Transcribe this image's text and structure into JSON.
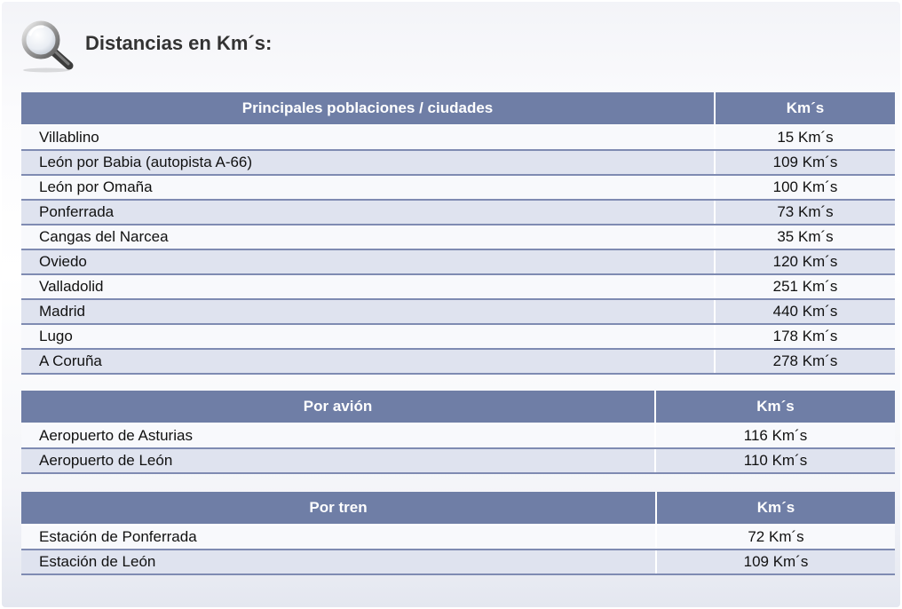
{
  "header": {
    "title": "Distancias en Km´s:",
    "icon": "magnifier-icon"
  },
  "colors": {
    "header_bg": "#6f7ea6",
    "row_even_bg": "#dfe3ef",
    "row_odd_bg": "#f8f9fc",
    "row_divider": "#7f8bb2"
  },
  "cities_table": {
    "col_place": "Principales poblaciones / ciudades",
    "col_km": "Km´s",
    "rows": [
      {
        "place": "Villablino",
        "km": "15 Km´s"
      },
      {
        "place": "León por Babia (autopista A-66)",
        "km": "109 Km´s"
      },
      {
        "place": "León por Omaña",
        "km": "100 Km´s"
      },
      {
        "place": "Ponferrada",
        "km": "73 Km´s"
      },
      {
        "place": "Cangas del Narcea",
        "km": "35 Km´s"
      },
      {
        "place": "Oviedo",
        "km": "120 Km´s"
      },
      {
        "place": "Valladolid",
        "km": "251 Km´s"
      },
      {
        "place": "Madrid",
        "km": "440 Km´s"
      },
      {
        "place": "Lugo",
        "km": "178 Km´s"
      },
      {
        "place": "A Coruña",
        "km": "278 Km´s"
      }
    ]
  },
  "plane_table": {
    "col_place": "Por avión",
    "col_km": "Km´s",
    "rows": [
      {
        "place": "Aeropuerto de Asturias",
        "km": "116 Km´s"
      },
      {
        "place": "Aeropuerto de León",
        "km": "110 Km´s"
      }
    ]
  },
  "train_table": {
    "col_place": "Por tren",
    "col_km": "Km´s",
    "rows": [
      {
        "place": "Estación de Ponferrada",
        "km": "72 Km´s"
      },
      {
        "place": "Estación de León",
        "km": "109 Km´s"
      }
    ]
  }
}
